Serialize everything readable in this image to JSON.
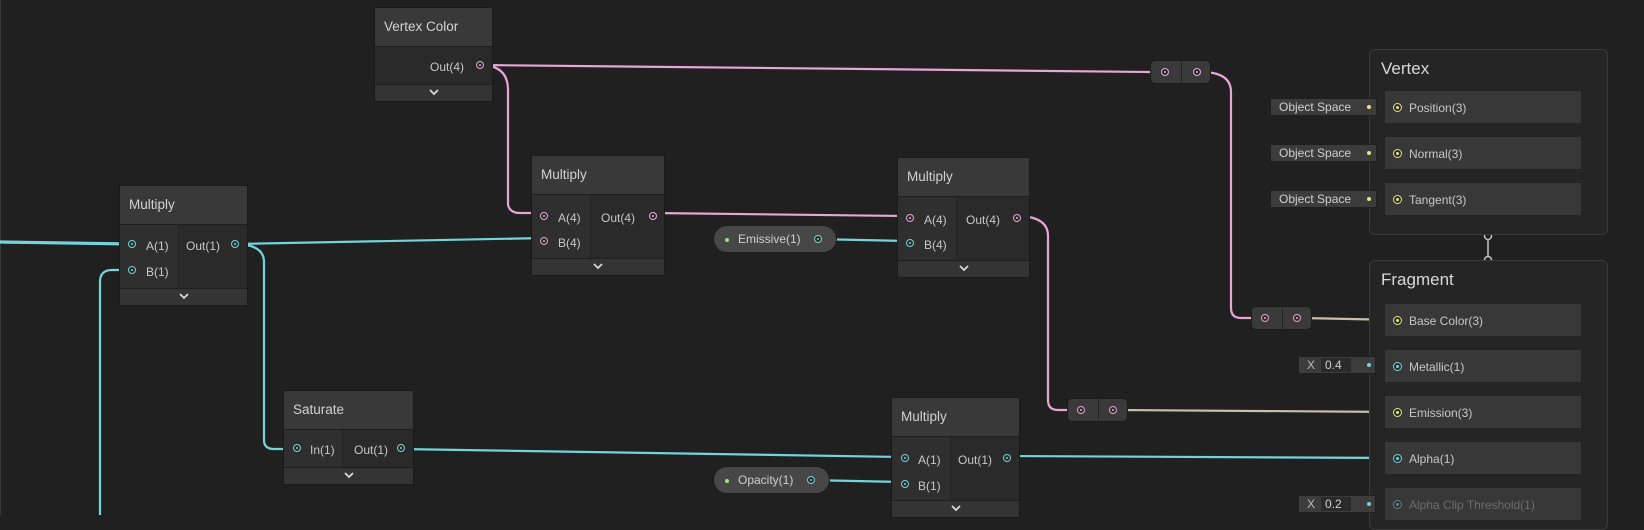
{
  "nodes": {
    "vertex_color": {
      "title": "Vertex Color",
      "out": "Out(4)"
    },
    "multiply_left": {
      "title": "Multiply",
      "in_a": "A(1)",
      "in_b": "B(1)",
      "out": "Out(1)"
    },
    "multiply_center": {
      "title": "Multiply",
      "in_a": "A(4)",
      "in_b": "B(4)",
      "out": "Out(4)"
    },
    "multiply_right": {
      "title": "Multiply",
      "in_a": "A(4)",
      "in_b": "B(4)",
      "out": "Out(4)"
    },
    "saturate": {
      "title": "Saturate",
      "in": "In(1)",
      "out": "Out(1)"
    },
    "multiply_bottom": {
      "title": "Multiply",
      "in_a": "A(1)",
      "in_b": "B(1)",
      "out": "Out(1)"
    }
  },
  "properties": {
    "emissive": "Emissive(1)",
    "opacity": "Opacity(1)"
  },
  "vertex_context": {
    "title": "Vertex",
    "slots": [
      {
        "label": "Position(3)",
        "tag": "Object Space"
      },
      {
        "label": "Normal(3)",
        "tag": "Object Space"
      },
      {
        "label": "Tangent(3)",
        "tag": "Object Space"
      }
    ]
  },
  "fragment_context": {
    "title": "Fragment",
    "slots": [
      {
        "label": "Base Color(3)"
      },
      {
        "label": "Metallic(1)",
        "field_label": "X",
        "field_value": "0.4"
      },
      {
        "label": "Emission(3)"
      },
      {
        "label": "Alpha(1)"
      },
      {
        "label": "Alpha Clip Threshold(1)",
        "field_label": "X",
        "field_value": "0.2"
      }
    ]
  },
  "colors": {
    "float": "#74d4dc",
    "vector4": "#e7a6d8",
    "vector3": "#e6e67a",
    "property": "#9be37c",
    "background": "#202020"
  },
  "icons": {
    "node_expand": "chevron-down-icon"
  }
}
